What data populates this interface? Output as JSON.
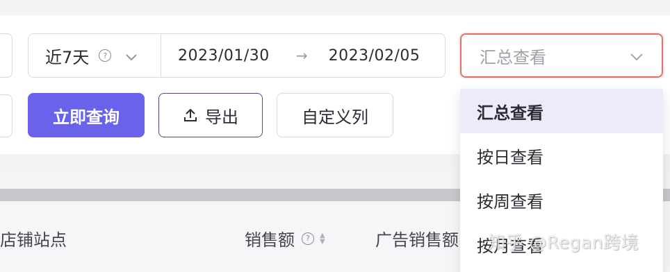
{
  "filters": {
    "range_label": "近7天",
    "range_help": "?",
    "start_date": "2023/01/30",
    "date_separator": "→",
    "end_date": "2023/02/05",
    "view_placeholder": "汇总查看"
  },
  "toolbar": {
    "query_label": "立即查询",
    "export_label": "导出",
    "columns_label": "自定义列"
  },
  "dropdown": {
    "options": [
      "汇总查看",
      "按日查看",
      "按周查看",
      "按月查看"
    ],
    "selected_index": 0
  },
  "table": {
    "columns": [
      "店铺站点",
      "销售额",
      "广告销售额"
    ],
    "help": "?"
  },
  "watermark": "知乎 @Regan跨境",
  "colors": {
    "accent": "#6a62ea",
    "focus_border": "#e0706a",
    "selected_option_bg": "#ecebfa"
  }
}
